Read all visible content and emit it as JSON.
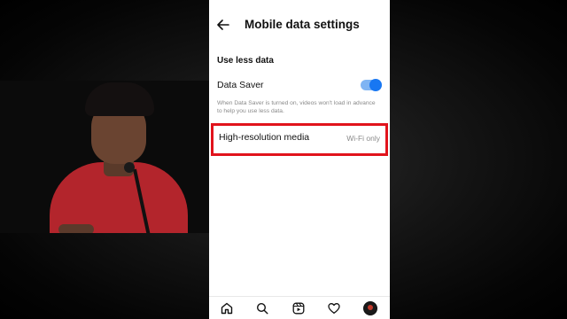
{
  "header": {
    "title": "Mobile data settings"
  },
  "use_less_data": {
    "section_title": "Use less data",
    "data_saver_label": "Data Saver",
    "data_saver_on": true,
    "data_saver_description": "When Data Saver is turned on, videos won't load in advance to help you use less data."
  },
  "high_resolution_media": {
    "label": "High-resolution media",
    "value": "Wi-Fi only"
  },
  "bottom_nav": {
    "items": [
      "home-icon",
      "search-icon",
      "reels-icon",
      "heart-icon",
      "profile-avatar"
    ]
  },
  "colors": {
    "accent": "#1877f2",
    "highlight": "#e1131c"
  }
}
